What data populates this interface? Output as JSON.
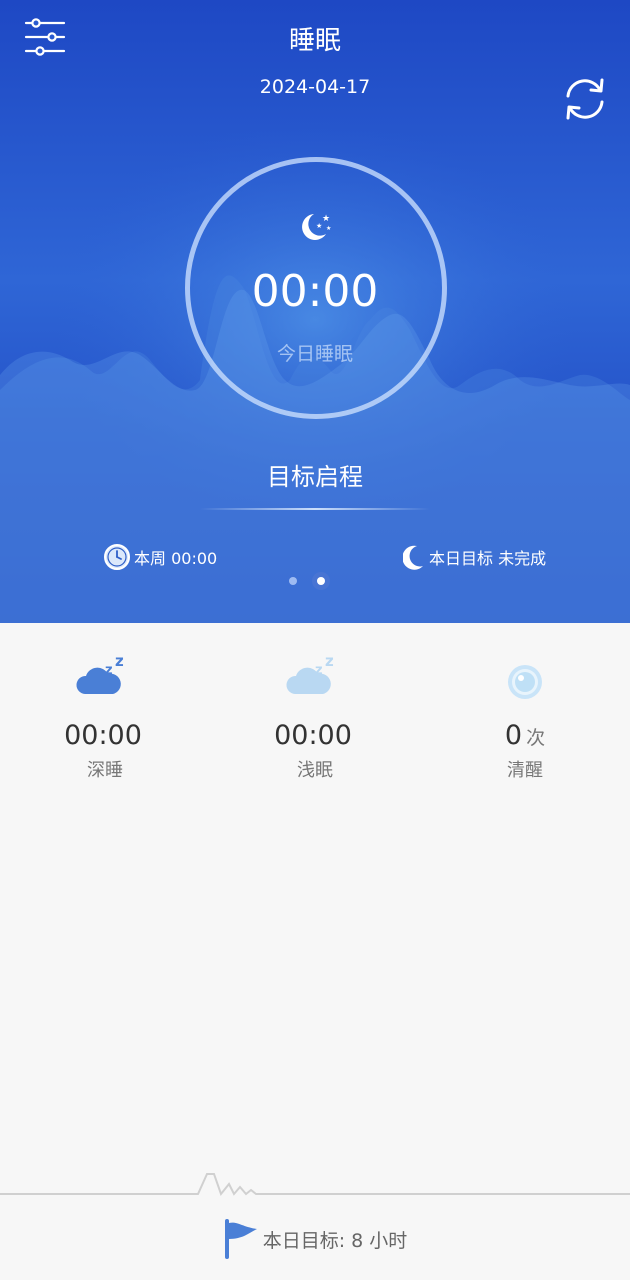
{
  "header": {
    "title": "睡眠",
    "date": "2024-04-17",
    "settings_icon": "sliders-icon",
    "sync_icon": "sync-icon"
  },
  "summary": {
    "moon_icon": "moon-stars-icon",
    "time": "00:00",
    "label": "今日睡眠"
  },
  "goal": {
    "title": "目标启程",
    "week_label": "本周 00:00",
    "day_goal_label": "本日目标 未完成",
    "pager_current": 2,
    "pager_total": 2
  },
  "stats": [
    {
      "icon": "deep-sleep-cloud-icon",
      "value": "00:00",
      "unit": "",
      "label": "深睡"
    },
    {
      "icon": "light-sleep-cloud-icon",
      "value": "00:00",
      "unit": "",
      "label": "浅眠"
    },
    {
      "icon": "awake-eye-icon",
      "value": "0",
      "unit": "次",
      "label": "清醒"
    }
  ],
  "footer": {
    "flag_icon": "flag-icon",
    "goal_text": "本日目标: 8 小时"
  },
  "colors": {
    "hero_bg": "#2452c8",
    "accent": "#4a7fd6",
    "page_bg": "#f7f7f7"
  }
}
